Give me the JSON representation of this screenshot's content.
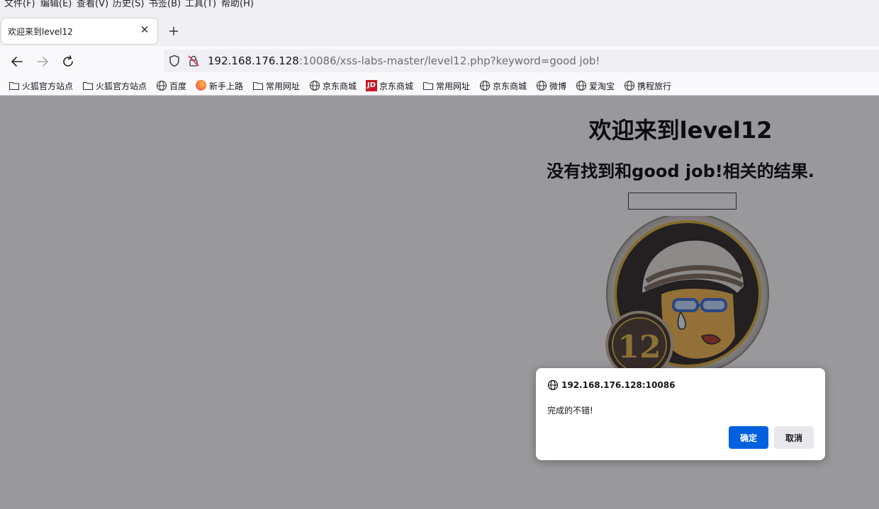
{
  "menu": [
    "文件(F)",
    "编辑(E)",
    "查看(V)",
    "历史(S)",
    "书签(B)",
    "工具(T)",
    "帮助(H)"
  ],
  "tab": {
    "title": "欢迎来到level12"
  },
  "url": {
    "host": "192.168.176.128",
    "rest": ":10086/xss-labs-master/level12.php?keyword=good job!"
  },
  "bookmarks": [
    {
      "label": "火狐官方站点",
      "icon": "folder-icon"
    },
    {
      "label": "火狐官方站点",
      "icon": "folder-icon"
    },
    {
      "label": "百度",
      "icon": "globe-icon"
    },
    {
      "label": "新手上路",
      "icon": "firefox-icon"
    },
    {
      "label": "常用网址",
      "icon": "folder-icon"
    },
    {
      "label": "京东商城",
      "icon": "globe-icon"
    },
    {
      "label": "京东商城",
      "icon": "jd-icon"
    },
    {
      "label": "常用网址",
      "icon": "folder-icon"
    },
    {
      "label": "京东商城",
      "icon": "globe-icon"
    },
    {
      "label": "微博",
      "icon": "globe-icon"
    },
    {
      "label": "爱淘宝",
      "icon": "globe-icon"
    },
    {
      "label": "携程旅行",
      "icon": "globe-icon"
    }
  ],
  "page": {
    "heading": "欢迎来到level12",
    "result": "没有找到和good job!相关的结果.",
    "search_value": "",
    "logo_number": "12"
  },
  "dialog": {
    "origin": "192.168.176.128:10086",
    "message": "完成的不错!",
    "ok_label": "确定",
    "cancel_label": "取消"
  },
  "colors": {
    "accent": "#0061e0",
    "overlay": "#1c1b22"
  }
}
